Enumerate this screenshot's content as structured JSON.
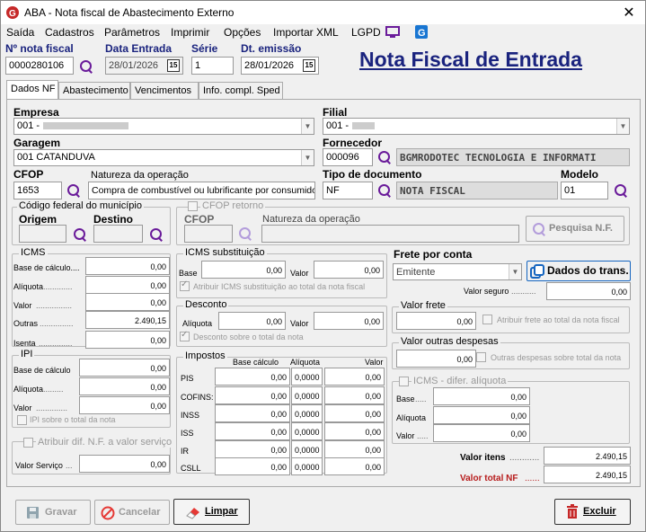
{
  "window": {
    "title": "ABA - Nota fiscal de Abastecimento Externo",
    "close": "✕"
  },
  "menu": [
    "Saída",
    "Cadastros",
    "Parâmetros",
    "Imprimir",
    "Opções",
    "Importar XML",
    "LGPD"
  ],
  "header": {
    "nf_label": "Nº nota fiscal",
    "nf_value": "0000280106",
    "data_entrada_label": "Data Entrada",
    "data_entrada_value": "28/01/2026",
    "serie_label": "Série",
    "serie_value": "1",
    "dt_emissao_label": "Dt. emissão",
    "dt_emissao_value": "28/01/2026",
    "big_title": "Nota Fiscal de Entrada",
    "cal_label": "15"
  },
  "tabs": [
    "Dados NF",
    "Abastecimento",
    "Vencimentos",
    "Info. compl. Sped"
  ],
  "fields": {
    "empresa_label": "Empresa",
    "empresa_value": "001 -",
    "filial_label": "Filial",
    "filial_value": "001 -",
    "garagem_label": "Garagem",
    "garagem_value": "001 CATANDUVA",
    "fornecedor_label": "Fornecedor",
    "fornecedor_code": "000096",
    "fornecedor_name": "BGMRODOTEC TECNOLOGIA E INFORMATI",
    "cfop_label": "CFOP",
    "cfop_value": "1653",
    "natureza_label": "Natureza da operação",
    "natureza_value": "Compra de combustível ou lubrificante por consumido",
    "tipo_doc_label": "Tipo de documento",
    "tipo_doc_code": "NF",
    "tipo_doc_name": "NOTA FISCAL",
    "modelo_label": "Modelo",
    "modelo_value": "01"
  },
  "codigo_municipio": {
    "title": "Código federal do município",
    "origem": "Origem",
    "destino": "Destino"
  },
  "cfop_retorno": {
    "title": "CFOP retorno",
    "cfop": "CFOP",
    "natureza": "Natureza da operação",
    "pesquisa": "Pesquisa N.F."
  },
  "icms": {
    "title": "ICMS",
    "base": "Base de cálculo....",
    "base_v": "0,00",
    "aliquota": "Alíquota",
    "aliquota_v": "0,00",
    "valor": "Valor",
    "valor_v": "0,00",
    "outras": "Outras",
    "outras_v": "2.490,15",
    "isenta": "Isenta",
    "isenta_v": "0,00"
  },
  "icms_sub": {
    "title": "ICMS substituição",
    "base": "Base",
    "base_v": "0,00",
    "valor": "Valor",
    "valor_v": "0,00",
    "atribuir": "Atribuir ICMS substituição ao total da nota fiscal"
  },
  "desconto": {
    "title": "Desconto",
    "aliquota": "Alíquota",
    "aliquota_v": "0,00",
    "valor": "Valor",
    "valor_v": "0,00",
    "chk": "Desconto sobre o total da nota"
  },
  "frete": {
    "title": "Frete por conta",
    "value": "Emitente",
    "dados_trans": "Dados do trans.",
    "valor_seguro": "Valor seguro",
    "valor_seguro_v": "0,00"
  },
  "valor_frete": {
    "title": "Valor frete",
    "value": "0,00",
    "chk": "Atribuir frete ao total da nota fiscal"
  },
  "outras_desp": {
    "title": "Valor outras despesas",
    "value": "0,00",
    "chk": "Outras despesas sobre total da nota"
  },
  "ipi": {
    "title": "IPI",
    "base": "Base de cálculo",
    "base_v": "0,00",
    "aliquota": "Alíquota",
    "aliquota_v": "0,00",
    "valor": "Valor",
    "valor_v": "0,00",
    "chk": "IPI sobre o total da nota"
  },
  "impostos": {
    "title": "Impostos",
    "col_base": "Base cálculo",
    "col_aliq": "Alíquota",
    "col_valor": "Valor",
    "rows": [
      {
        "name": "PIS",
        "base": "0,00",
        "aliq": "0,0000",
        "valor": "0,00"
      },
      {
        "name": "COFINS:",
        "base": "0,00",
        "aliq": "0,0000",
        "valor": "0,00"
      },
      {
        "name": "INSS",
        "base": "0,00",
        "aliq": "0,0000",
        "valor": "0,00"
      },
      {
        "name": "ISS",
        "base": "0,00",
        "aliq": "0,0000",
        "valor": "0,00"
      },
      {
        "name": "IR",
        "base": "0,00",
        "aliq": "0,0000",
        "valor": "0,00"
      },
      {
        "name": "CSLL",
        "base": "0,00",
        "aliq": "0,0000",
        "valor": "0,00"
      }
    ]
  },
  "icms_difer": {
    "title": "ICMS - difer. alíquota",
    "base": "Base",
    "base_v": "0,00",
    "aliquota": "Alíquota",
    "aliquota_v": "0,00",
    "valor": "Valor",
    "valor_v": "0,00"
  },
  "atribuir_servico": {
    "title": "Atribuir dif. N.F. a valor serviço",
    "valor": "Valor Serviço",
    "valor_v": "0,00"
  },
  "totais": {
    "valor_itens": "Valor itens",
    "valor_itens_v": "2.490,15",
    "valor_total": "Valor total NF",
    "valor_total_v": "2.490,15"
  },
  "buttons": {
    "gravar": "Gravar",
    "cancelar": "Cancelar",
    "limpar": "Limpar",
    "excluir": "Excluir"
  },
  "colors": {
    "accent": "#1a237e",
    "purple": "#6a1b9a",
    "red": "#c62828"
  }
}
